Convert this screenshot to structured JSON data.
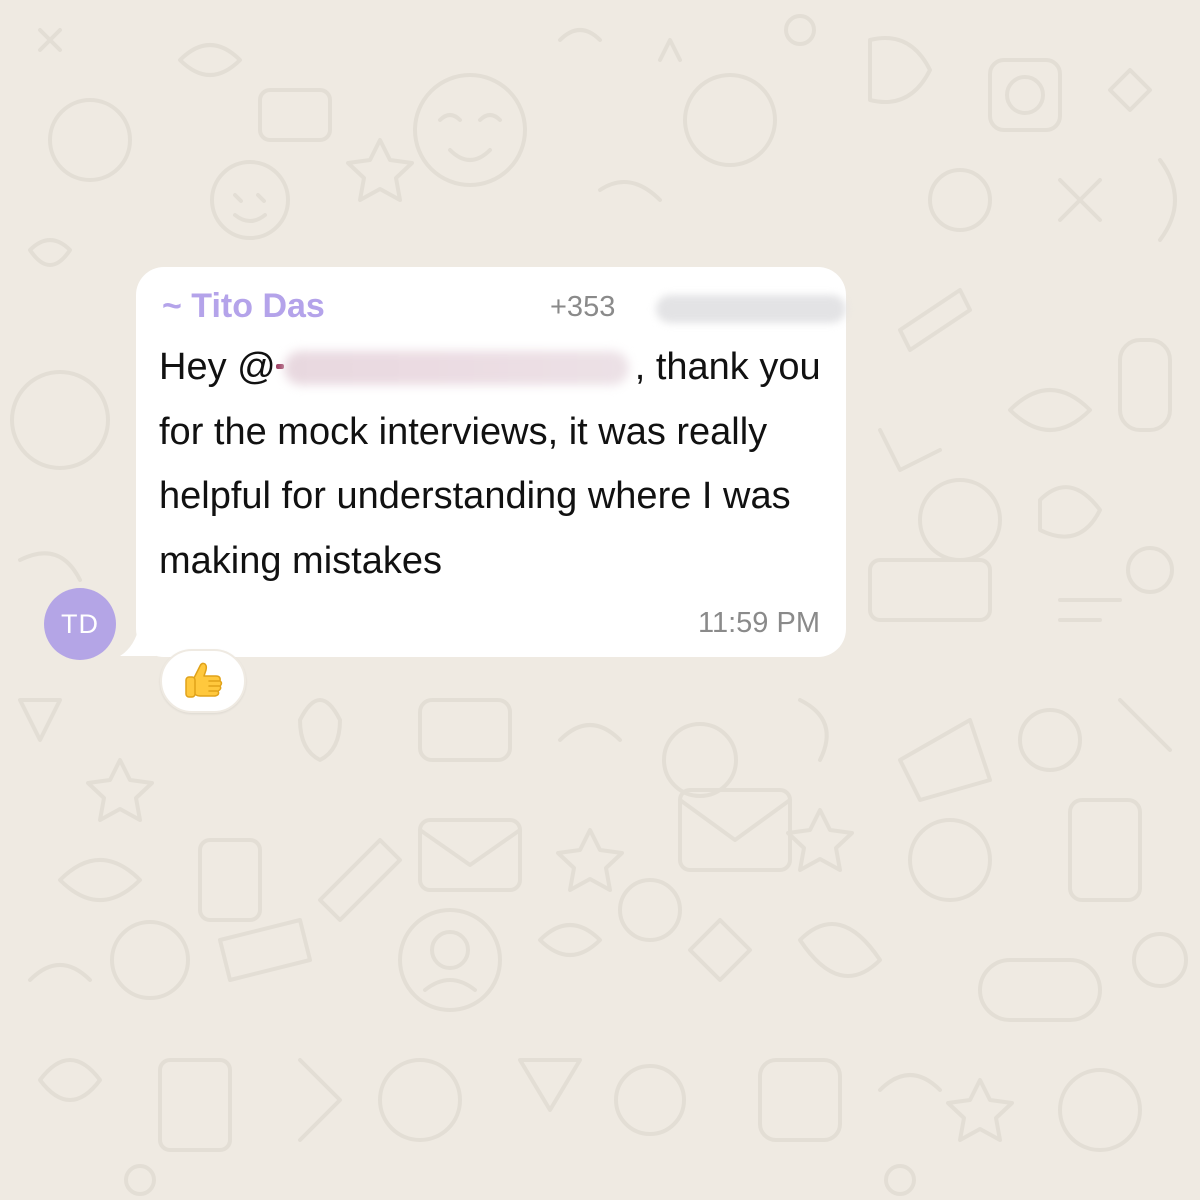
{
  "chat": {
    "background_color": "#efeae2"
  },
  "message": {
    "avatar_initials": "TD",
    "avatar_color": "#b4a5e6",
    "sender_name": "~ Tito Das",
    "sender_name_color": "#b4a3ea",
    "sender_phone_prefix": "+353",
    "mention_prefix": "Hey @",
    "text_after_mention": ", thank you for the mock interviews, it was really helpful for understanding where I was making mistakes",
    "time": "11:59 PM"
  },
  "reaction": {
    "icon": "thumbs-up-icon",
    "color": "#ffc83d"
  }
}
